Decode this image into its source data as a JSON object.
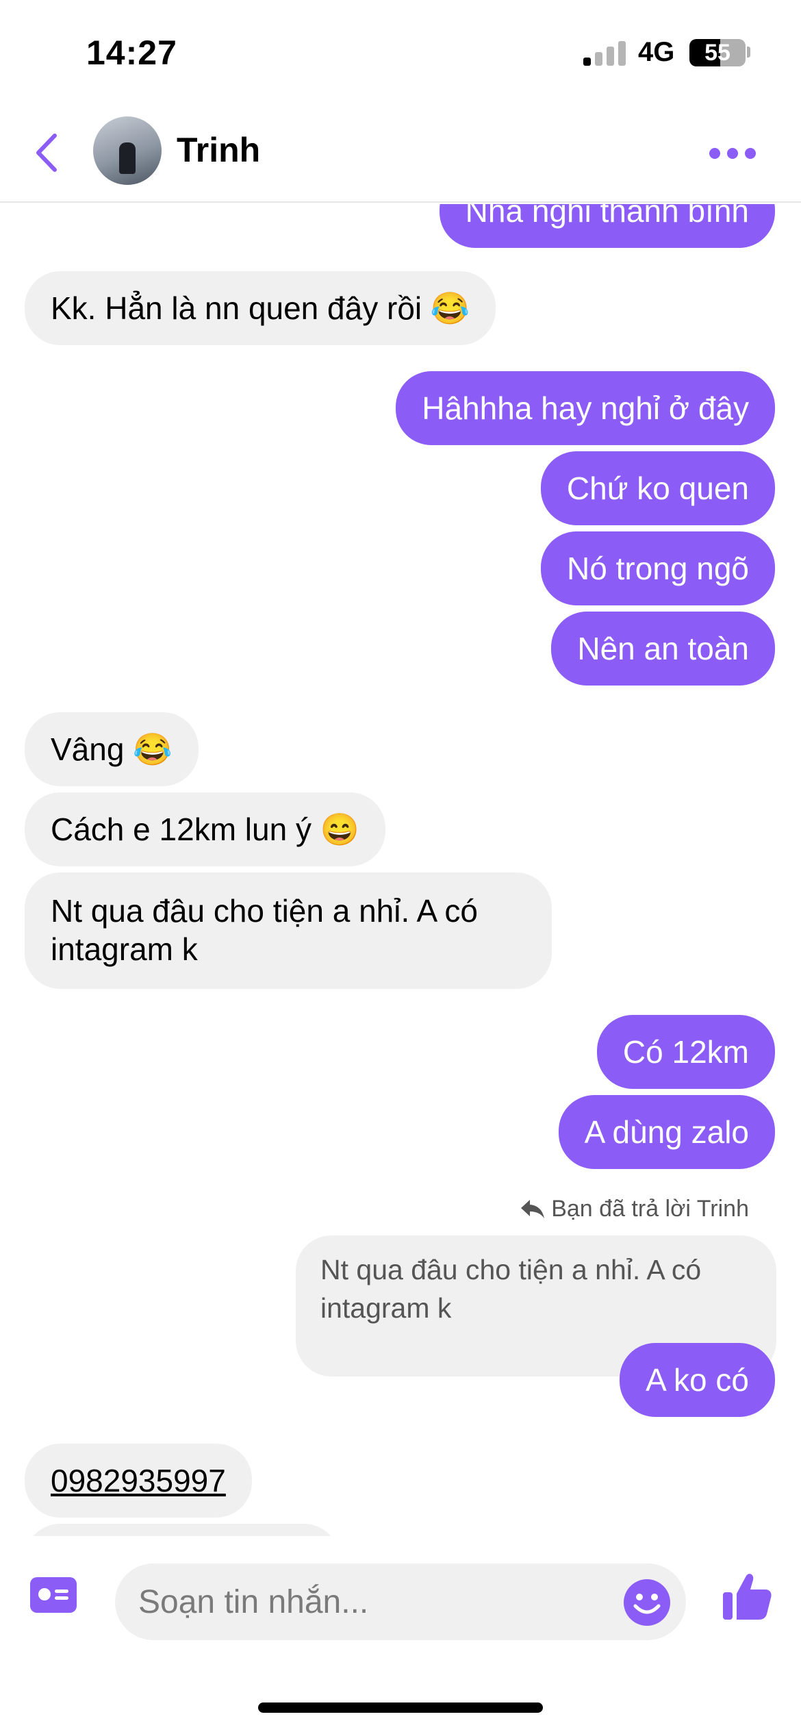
{
  "status_bar": {
    "time": "14:27",
    "network": "4G",
    "battery": "55",
    "battery_level": 0.55,
    "signal_bars_active": 1,
    "signal_bars_total": 4
  },
  "header": {
    "contact_name": "Trinh",
    "back_icon": "chevron-left-icon",
    "more_icon": "more-horizontal-icon"
  },
  "colors": {
    "accent": "#8b5cf6",
    "incoming_bubble": "#f0f0f0"
  },
  "messages": {
    "m0": {
      "direction": "outgoing",
      "text": "Nhà nghỉ thanh bình"
    },
    "m1": {
      "direction": "incoming",
      "text": "Kk. Hẳn là nn quen đây rồi",
      "emoji": "😂"
    },
    "m2": {
      "direction": "outgoing",
      "text": "Hâhhha hay nghỉ ở đây"
    },
    "m3": {
      "direction": "outgoing",
      "text": "Chứ ko quen"
    },
    "m4": {
      "direction": "outgoing",
      "text": "Nó trong ngõ"
    },
    "m5": {
      "direction": "outgoing",
      "text": "Nên an toàn"
    },
    "m6": {
      "direction": "incoming",
      "text": "Vâng",
      "emoji": "😂"
    },
    "m7": {
      "direction": "incoming",
      "text": "Cách e 12km lun ý",
      "emoji": "😄"
    },
    "m8": {
      "direction": "incoming",
      "line1": "Nt qua đâu cho tiện a nhỉ. A có",
      "line2": "intagram k"
    },
    "m9": {
      "direction": "outgoing",
      "text": "Có 12km"
    },
    "m10": {
      "direction": "outgoing",
      "text": "A dùng zalo"
    },
    "m11": {
      "direction": "outgoing",
      "text": "A ko có"
    },
    "m12": {
      "direction": "incoming",
      "text": "0982935997"
    }
  },
  "reply": {
    "label": "Bạn đã trả lời Trinh",
    "quoted_line1": "Nt qua đâu cho tiện a nhỉ. A có",
    "quoted_line2": "intagram k",
    "icon": "reply-arrow-icon"
  },
  "composer": {
    "placeholder": "Soạn tin nhắn...",
    "value": "",
    "left_icon": "contact-card-icon",
    "emoji_icon": "smiley-icon",
    "send_icon": "thumbs-up-icon"
  }
}
